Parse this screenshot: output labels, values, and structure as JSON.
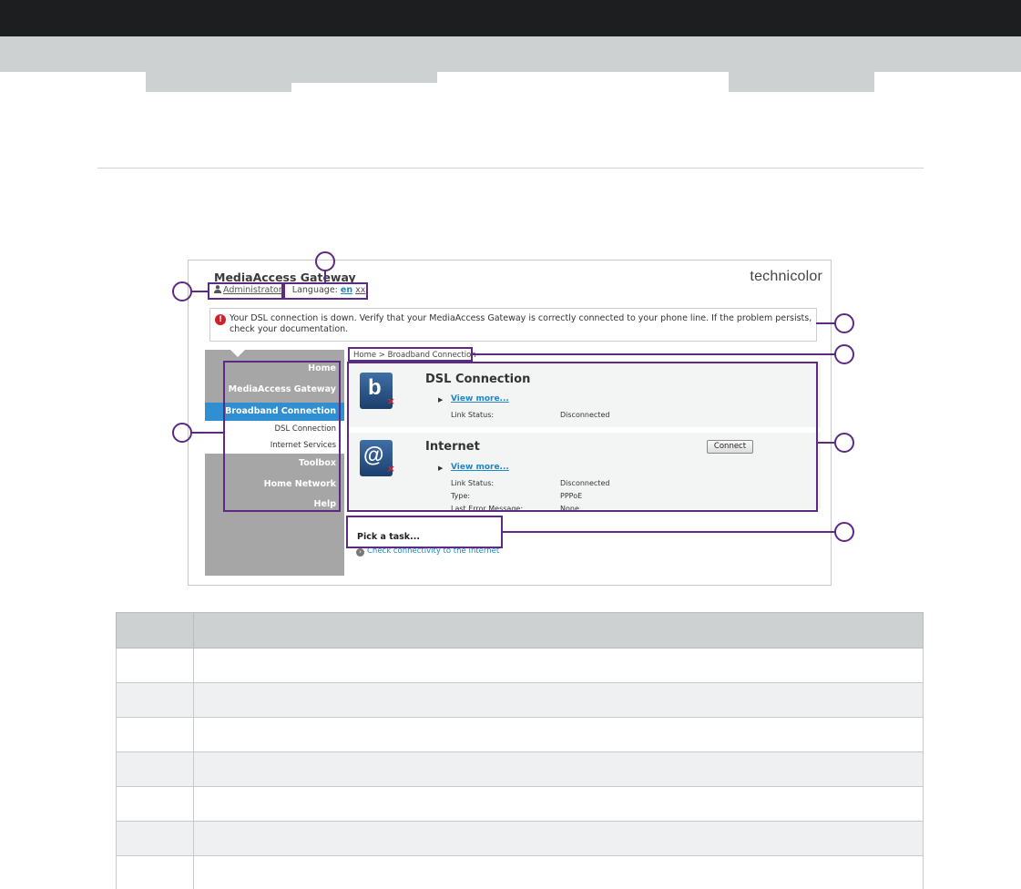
{
  "screenshot": {
    "app_title": "MediaAccess Gateway",
    "brand": "technicolor",
    "user": "Administrator",
    "language_label": "Language:",
    "languages": [
      "en",
      "xx"
    ],
    "alert_text": "Your DSL connection is down. Verify that your MediaAccess Gateway is correctly connected to your phone line. If the problem persists, check your documentation.",
    "breadcrumb": "Home > Broadband Connection",
    "nav": {
      "home": "Home",
      "gateway": "MediaAccess Gateway",
      "broadband": "Broadband Connection",
      "dsl_sub": "DSL Connection",
      "internet_sub": "Internet Services",
      "toolbox": "Toolbox",
      "home_network": "Home Network",
      "help": "Help"
    },
    "dsl": {
      "title": "DSL Connection",
      "view_more": "View more...",
      "link_status_label": "Link Status:",
      "link_status_value": "Disconnected"
    },
    "internet": {
      "title": "Internet",
      "view_more": "View more...",
      "connect_button": "Connect",
      "link_status_label": "Link Status:",
      "link_status_value": "Disconnected",
      "type_label": "Type:",
      "type_value": "PPPoE",
      "error_label": "Last Error Message:",
      "error_value": "None"
    },
    "tasks": {
      "title": "Pick a task...",
      "link": "Check connectivity to the Internet"
    },
    "icons": [
      "user-icon",
      "error-icon",
      "broadband-icon",
      "internet-at-icon",
      "arrow-right-icon",
      "task-bullet-icon"
    ]
  },
  "colors": {
    "topbar": "#1d1e20",
    "subbar": "#cdd1d2",
    "callout": "#5c2a82",
    "nav_active": "#2f8fd0",
    "link": "#1e88c9",
    "alert_icon": "#d0202a"
  },
  "legend_table": {
    "row_count": 7
  }
}
